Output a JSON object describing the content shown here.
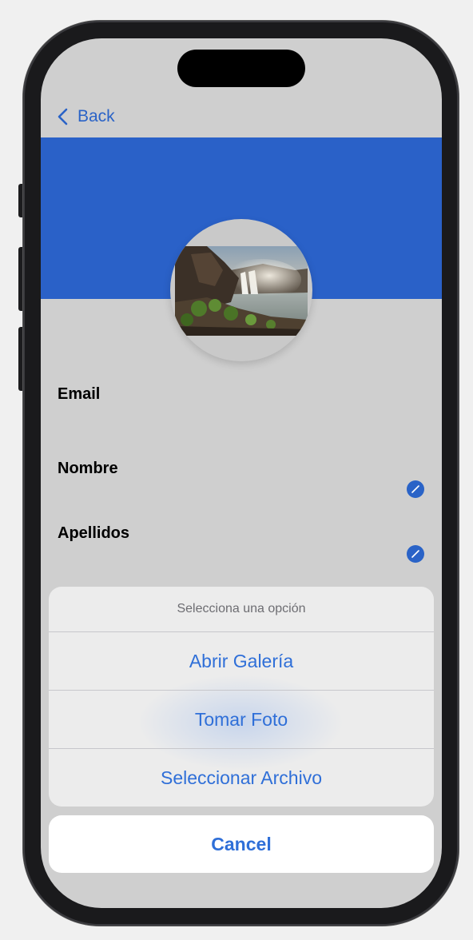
{
  "nav": {
    "back_label": "Back"
  },
  "profile": {
    "fields": [
      {
        "label": "Email",
        "editable": false
      },
      {
        "label": "Nombre",
        "editable": true
      },
      {
        "label": "Apellidos",
        "editable": true
      }
    ]
  },
  "action_sheet": {
    "title": "Selecciona una opción",
    "options": [
      {
        "label": "Abrir Galería"
      },
      {
        "label": "Tomar Foto"
      },
      {
        "label": "Seleccionar Archivo"
      }
    ],
    "cancel_label": "Cancel"
  },
  "colors": {
    "accent": "#2a63c7",
    "banner": "#2a61c8",
    "screen_background": "#cfcfcf"
  },
  "icons": {
    "back": "chevron-left-icon",
    "edit": "pencil-icon"
  }
}
